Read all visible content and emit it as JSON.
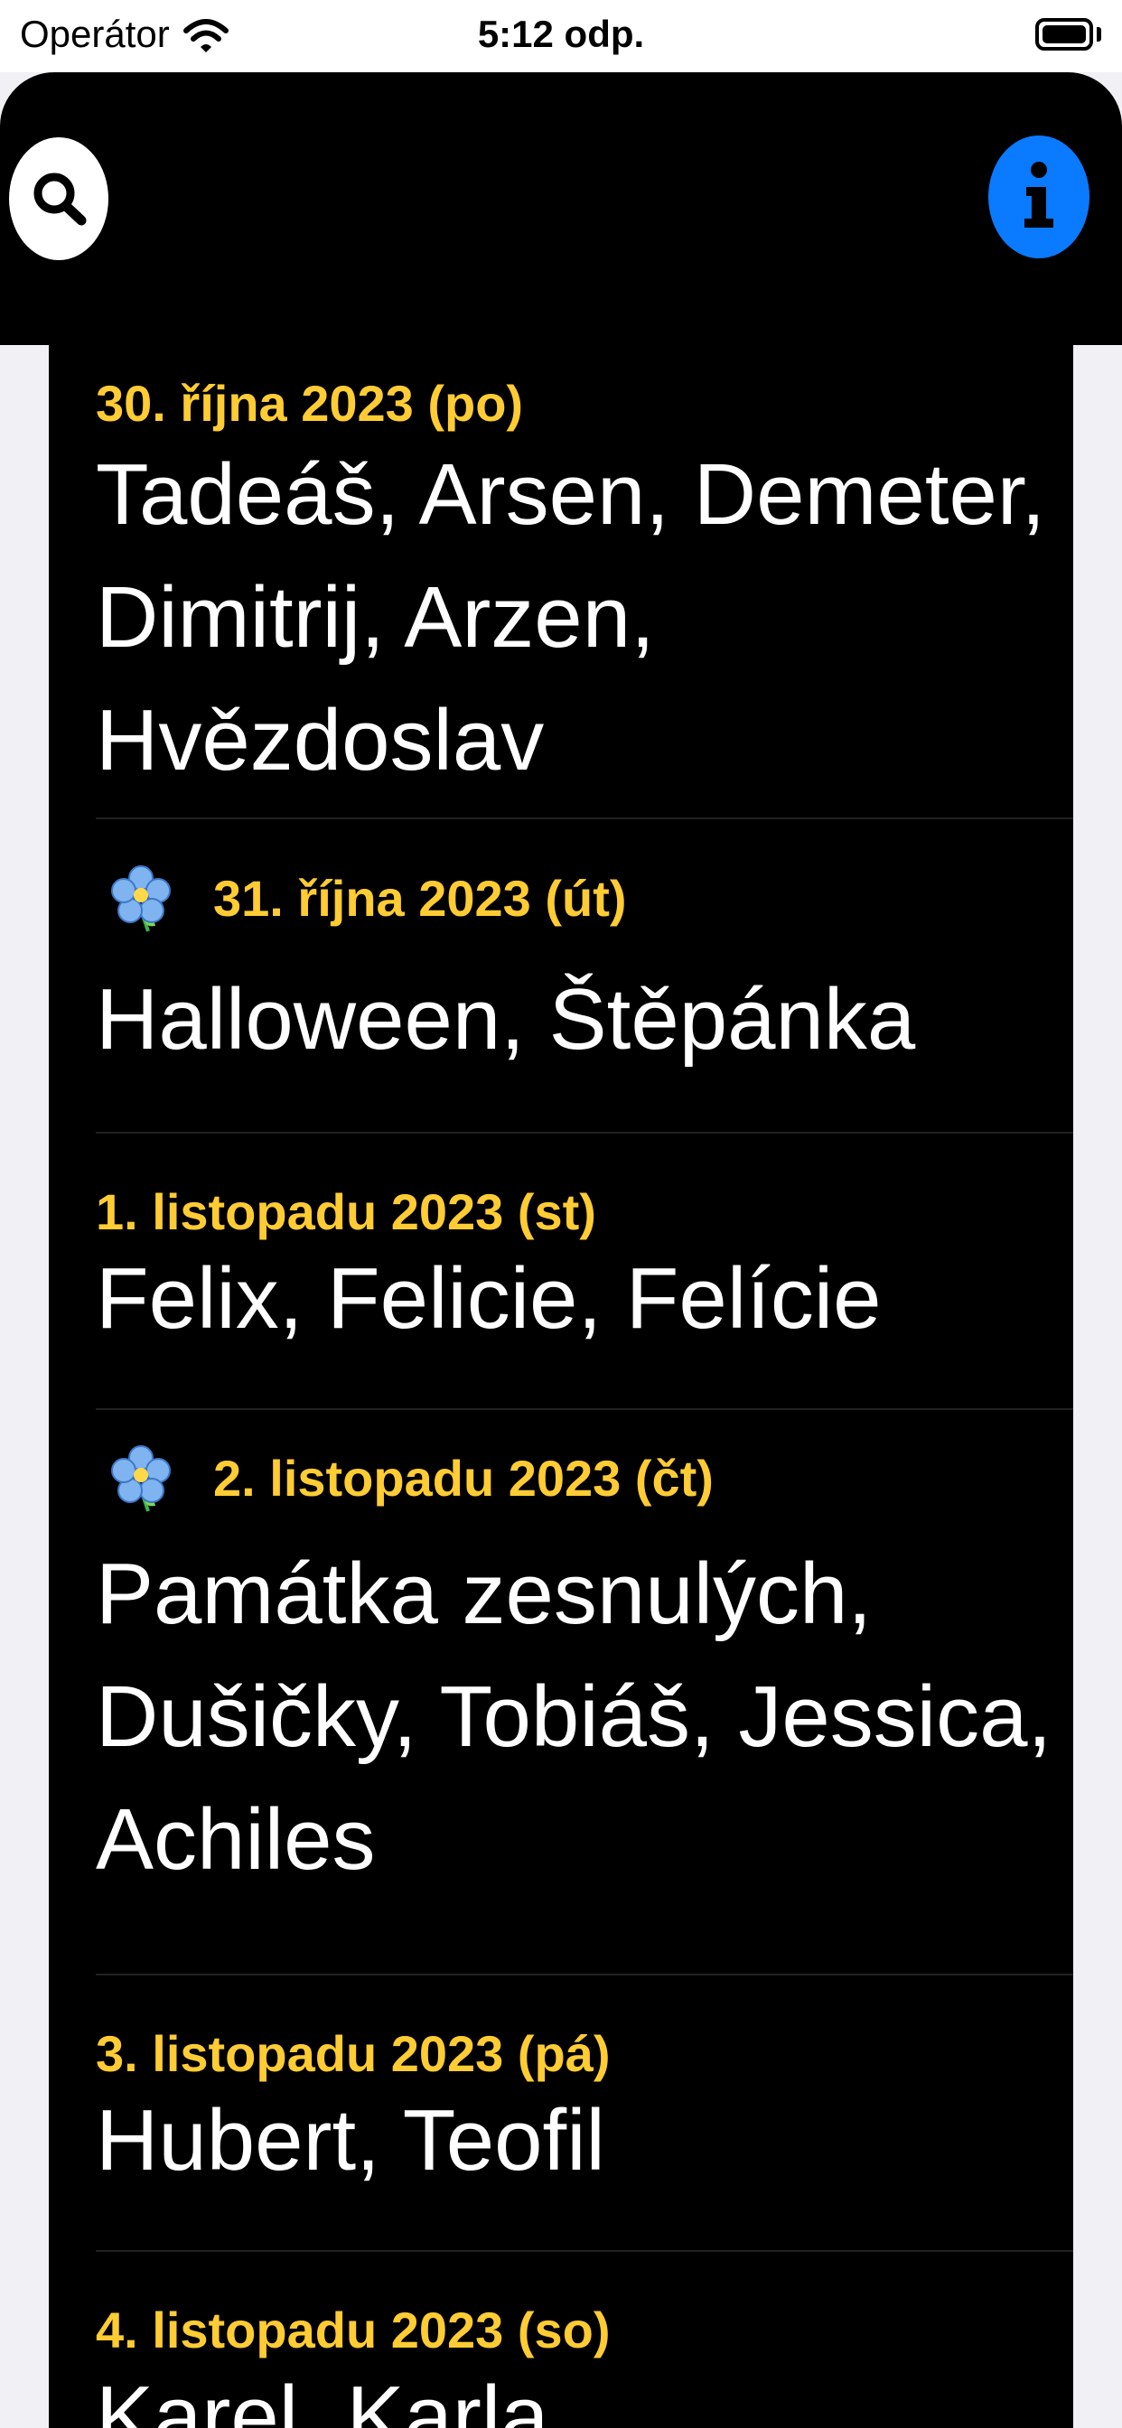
{
  "status_bar": {
    "carrier": "Operátor",
    "time": "5:12 odp."
  },
  "header": {
    "search_icon": "magnifying-glass-icon",
    "info_icon": "info-icon",
    "accent_color": "#0A7AFF"
  },
  "list": {
    "date_color": "#FFCC33",
    "items": [
      {
        "date": "30. října 2023 (po)",
        "names": "Tadeáš, Arsen, Demeter, Dimitrij, Arzen, Hvězdoslav",
        "holiday": false
      },
      {
        "date": "31. října 2023 (út)",
        "names": "Halloween, Štěpánka",
        "holiday": true,
        "icon": "forget-me-not-flower-icon"
      },
      {
        "date": "1. listopadu 2023 (st)",
        "names": "Felix, Felicie, Felície",
        "holiday": false
      },
      {
        "date": "2. listopadu 2023 (čt)",
        "names": "Památka zesnulých, Dušičky, Tobiáš, Jessica, Achiles",
        "holiday": true,
        "icon": "forget-me-not-flower-icon"
      },
      {
        "date": "3. listopadu 2023 (pá)",
        "names": "Hubert, Teofil",
        "holiday": false
      },
      {
        "date": "4. listopadu 2023 (so)",
        "names": "Karel, Karla",
        "holiday": false
      }
    ]
  }
}
